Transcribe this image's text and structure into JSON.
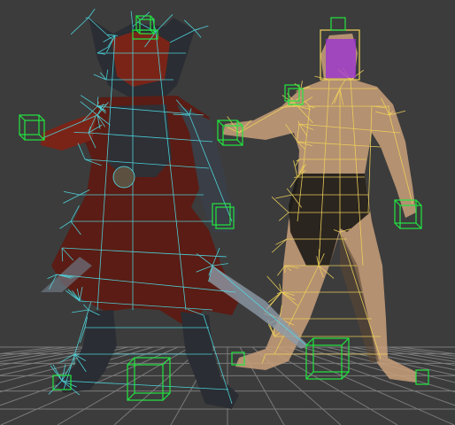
{
  "viewport": {
    "background": "#3c3c3c",
    "grid_color": "#8a8a8a",
    "wireframe_cyan": "#4fe0e8",
    "wireframe_yellow": "#f0d25a",
    "controller_green": "#22e640",
    "head_controller_purple": "#9b2fd8",
    "skin_tone": "#c9a07a",
    "armor_red": "#7a2418",
    "armor_dark": "#2a2d33"
  },
  "objects": [
    {
      "name": "armored-character-mesh",
      "icon": "wireframe-character-icon"
    },
    {
      "name": "base-body-mesh",
      "icon": "wireframe-body-icon"
    }
  ]
}
